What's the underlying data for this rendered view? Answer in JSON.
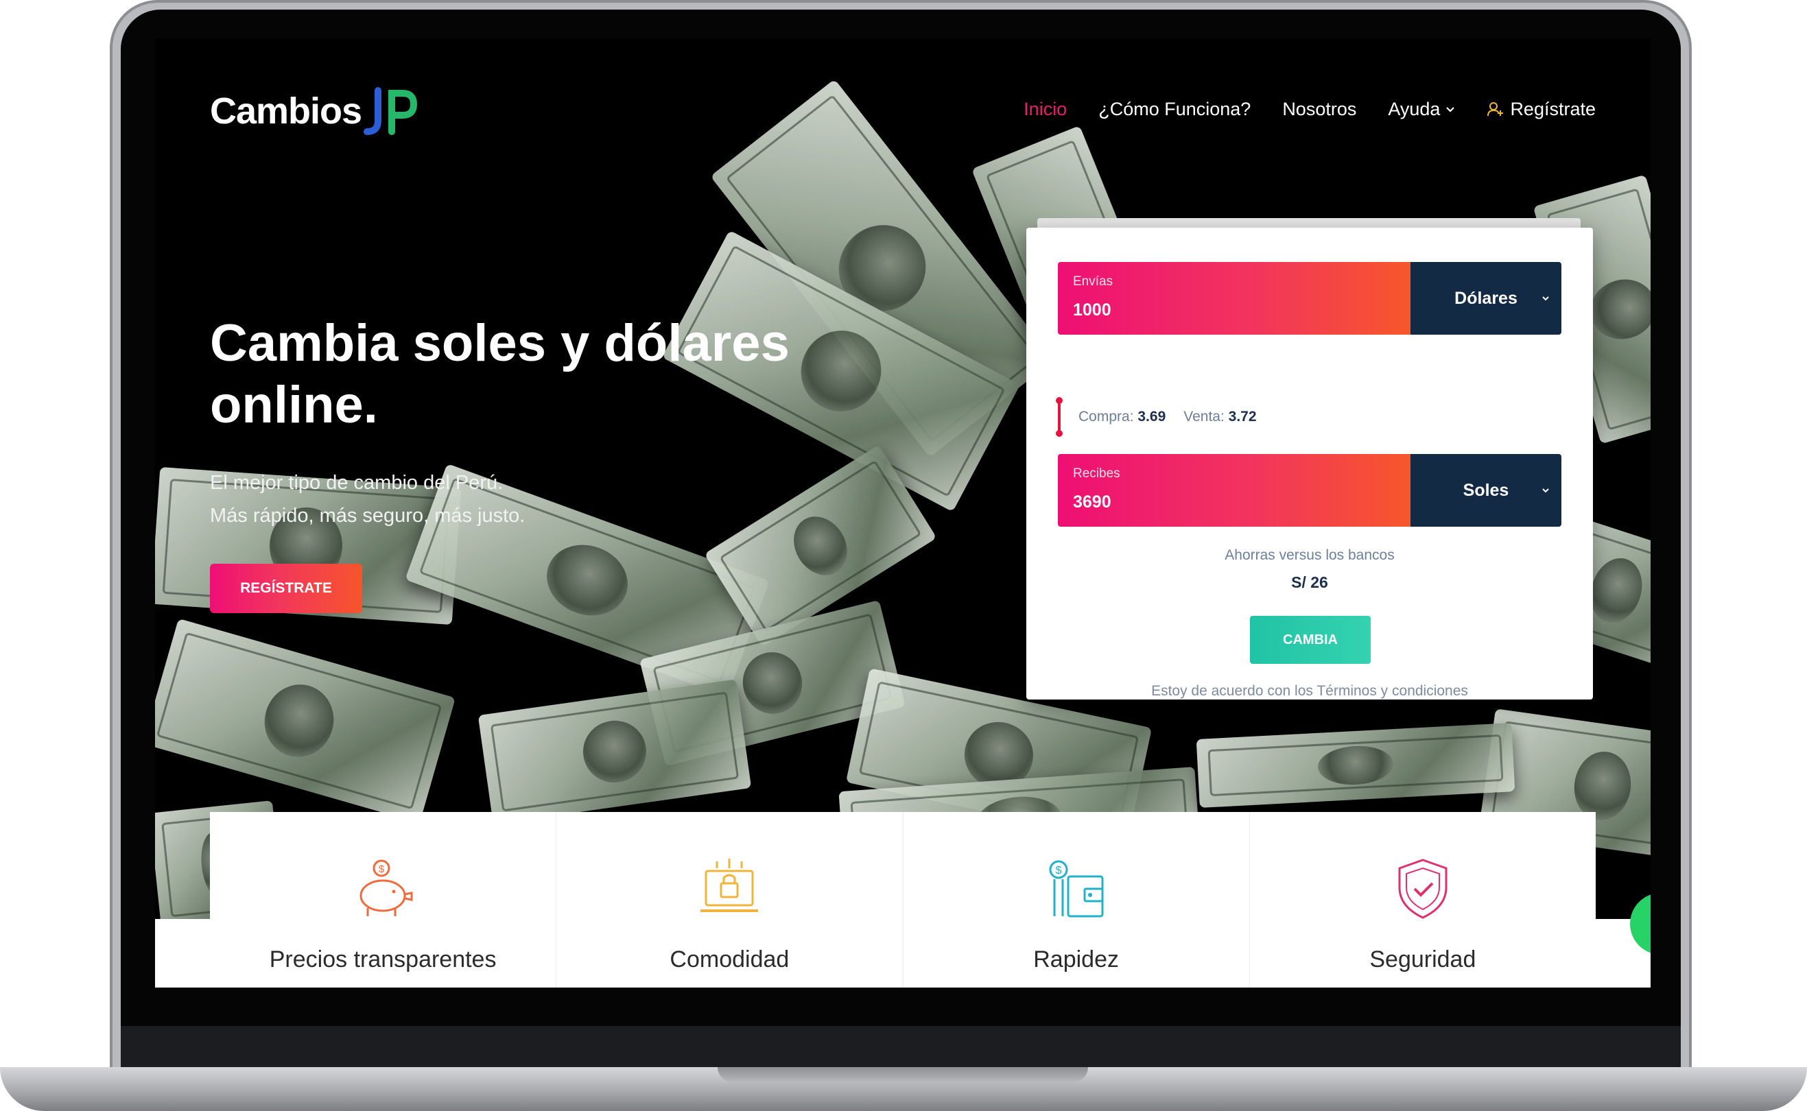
{
  "nav": {
    "logo_text": "Cambios",
    "logo_mark_text": "JP",
    "items": [
      {
        "label": "Inicio",
        "active": true
      },
      {
        "label": "¿Cómo Funciona?",
        "active": false
      },
      {
        "label": "Nosotros",
        "active": false
      },
      {
        "label": "Ayuda",
        "active": false,
        "dropdown": true
      },
      {
        "label": "Regístrate",
        "active": false,
        "icon": "user-add-icon"
      }
    ]
  },
  "hero": {
    "title": "Cambia soles y dólares online.",
    "subtitle_line1": "El mejor tipo de cambio del Perú.",
    "subtitle_line2": "Más rápido, más seguro, más justo.",
    "cta_label": "REGÍSTRATE"
  },
  "converter": {
    "send": {
      "label": "Envías",
      "value": "1000",
      "currency": "Dólares"
    },
    "rates": {
      "buy_label": "Compra:",
      "buy_value": "3.69",
      "sell_label": "Venta:",
      "sell_value": "3.72"
    },
    "receive": {
      "label": "Recibes",
      "value": "3690",
      "currency": "Soles"
    },
    "savings_label": "Ahorras versus los bancos",
    "savings_value": "S/ 26",
    "button_label": "CAMBIA",
    "terms_text": "Estoy de acuerdo con los Términos y condiciones"
  },
  "features": [
    {
      "label": "Precios transparentes",
      "icon": "piggy-bank-icon"
    },
    {
      "label": "Comodidad",
      "icon": "laptop-lock-icon"
    },
    {
      "label": "Rapidez",
      "icon": "wallet-money-icon"
    },
    {
      "label": "Seguridad",
      "icon": "shield-check-icon"
    }
  ],
  "colors": {
    "accent_pink": "#ee0f74",
    "accent_orange": "#f7552c",
    "navy": "#132a45",
    "teal": "#21c3a6",
    "nav_active": "#e61e6e"
  }
}
